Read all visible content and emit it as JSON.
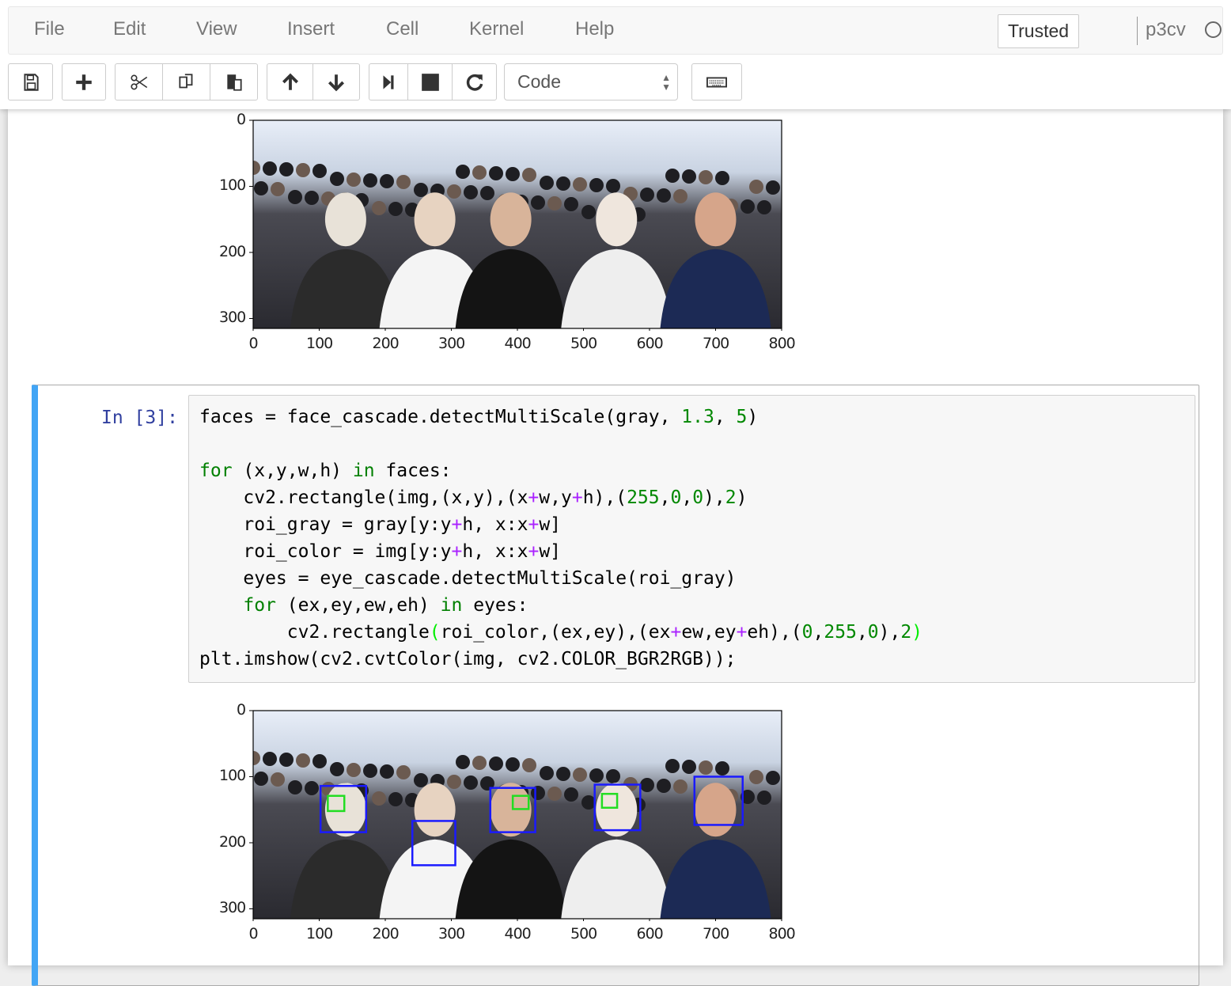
{
  "menubar": {
    "items": [
      "File",
      "Edit",
      "View",
      "Insert",
      "Cell",
      "Kernel",
      "Help"
    ],
    "trusted": "Trusted",
    "kernel_name": "p3cv"
  },
  "toolbar": {
    "buttons": [
      {
        "name": "save-button",
        "icon": "floppy-icon"
      },
      {
        "name": "insert-cell-button",
        "icon": "plus-icon"
      },
      {
        "name": "cut-button",
        "icon": "scissors-icon"
      },
      {
        "name": "copy-button",
        "icon": "copy-icon"
      },
      {
        "name": "paste-button",
        "icon": "paste-icon"
      },
      {
        "name": "move-up-button",
        "icon": "arrow-up-icon"
      },
      {
        "name": "move-down-button",
        "icon": "arrow-down-icon"
      },
      {
        "name": "run-button",
        "icon": "step-forward-icon"
      },
      {
        "name": "interrupt-button",
        "icon": "stop-icon"
      },
      {
        "name": "restart-button",
        "icon": "refresh-icon"
      },
      {
        "name": "command-palette-button",
        "icon": "keyboard-icon"
      }
    ],
    "cell_type": "Code"
  },
  "colors": {
    "accent": "#42A5F5",
    "prompt": "#303F9F",
    "keyword": "#008000",
    "operator": "#AA22FF",
    "face_box": "#1a1aff",
    "eye_box": "#22dd22"
  },
  "cell": {
    "prompt": "In [3]:",
    "code_lines": [
      [
        [
          "faces = face_cascade.detectMultiScale(gray, ",
          ""
        ],
        [
          "1.3",
          "nm"
        ],
        [
          ", ",
          ""
        ],
        [
          "5",
          "nm"
        ],
        [
          ")",
          ""
        ]
      ],
      [],
      [
        [
          "for",
          "kw"
        ],
        [
          " (x,y,w,h) ",
          ""
        ],
        [
          "in",
          "kw"
        ],
        [
          " faces:",
          ""
        ]
      ],
      [
        [
          "    cv2.rectangle(img,(x,y),(x",
          ""
        ],
        [
          "+",
          "op"
        ],
        [
          "w,y",
          ""
        ],
        [
          "+",
          "op"
        ],
        [
          "h),(",
          ""
        ],
        [
          "255",
          "nm"
        ],
        [
          ",",
          ""
        ],
        [
          "0",
          "nm"
        ],
        [
          ",",
          ""
        ],
        [
          "0",
          "nm"
        ],
        [
          "),",
          ""
        ],
        [
          "2",
          "nm"
        ],
        [
          ")",
          ""
        ]
      ],
      [
        [
          "    roi_gray = gray[y:y",
          ""
        ],
        [
          "+",
          "op"
        ],
        [
          "h, x:x",
          ""
        ],
        [
          "+",
          "op"
        ],
        [
          "w]",
          ""
        ]
      ],
      [
        [
          "    roi_color = img[y:y",
          ""
        ],
        [
          "+",
          "op"
        ],
        [
          "h, x:x",
          ""
        ],
        [
          "+",
          "op"
        ],
        [
          "w]",
          ""
        ]
      ],
      [
        [
          "    eyes = eye_cascade.detectMultiScale(roi_gray)",
          ""
        ]
      ],
      [
        [
          "    ",
          ""
        ],
        [
          "for",
          "kw"
        ],
        [
          " (ex,ey,ew,eh) ",
          ""
        ],
        [
          "in",
          "kw"
        ],
        [
          " eyes:",
          ""
        ]
      ],
      [
        [
          "        cv2.rectangle",
          ""
        ],
        [
          "(",
          "br"
        ],
        [
          "roi_color,(ex,ey),(ex",
          ""
        ],
        [
          "+",
          "op"
        ],
        [
          "ew,ey",
          ""
        ],
        [
          "+",
          "op"
        ],
        [
          "eh),(",
          ""
        ],
        [
          "0",
          "nm"
        ],
        [
          ",",
          ""
        ],
        [
          "255",
          "nm"
        ],
        [
          ",",
          ""
        ],
        [
          "0",
          "nm"
        ],
        [
          "),",
          ""
        ],
        [
          "2",
          "nm"
        ],
        [
          ")",
          "br"
        ]
      ],
      [
        [
          "plt.imshow(cv2.cvtColor(img, cv2.COLOR_BGR2RGB));",
          ""
        ]
      ]
    ]
  },
  "chart_data": [
    {
      "type": "image",
      "xlim": [
        0,
        800
      ],
      "ylim": [
        315,
        0
      ],
      "xticks": [
        "0",
        "100",
        "200",
        "300",
        "400",
        "500",
        "600",
        "700",
        "800"
      ],
      "yticks": [
        "0",
        "100",
        "200",
        "300"
      ],
      "faces": [],
      "eyes": []
    },
    {
      "type": "image",
      "xlim": [
        0,
        800
      ],
      "ylim": [
        315,
        0
      ],
      "xticks": [
        "0",
        "100",
        "200",
        "300",
        "400",
        "500",
        "600",
        "700",
        "800"
      ],
      "yticks": [
        "0",
        "100",
        "200",
        "300"
      ],
      "faces": [
        {
          "x": 102,
          "y": 114,
          "w": 69,
          "h": 70
        },
        {
          "x": 241,
          "y": 167,
          "w": 65,
          "h": 67
        },
        {
          "x": 359,
          "y": 117,
          "w": 68,
          "h": 67
        },
        {
          "x": 517,
          "y": 112,
          "w": 69,
          "h": 69
        },
        {
          "x": 668,
          "y": 100,
          "w": 73,
          "h": 73
        }
      ],
      "eyes": [
        {
          "x": 113,
          "y": 129,
          "w": 25,
          "h": 23
        },
        {
          "x": 393,
          "y": 129,
          "w": 24,
          "h": 20
        },
        {
          "x": 528,
          "y": 126,
          "w": 23,
          "h": 21
        }
      ]
    }
  ]
}
